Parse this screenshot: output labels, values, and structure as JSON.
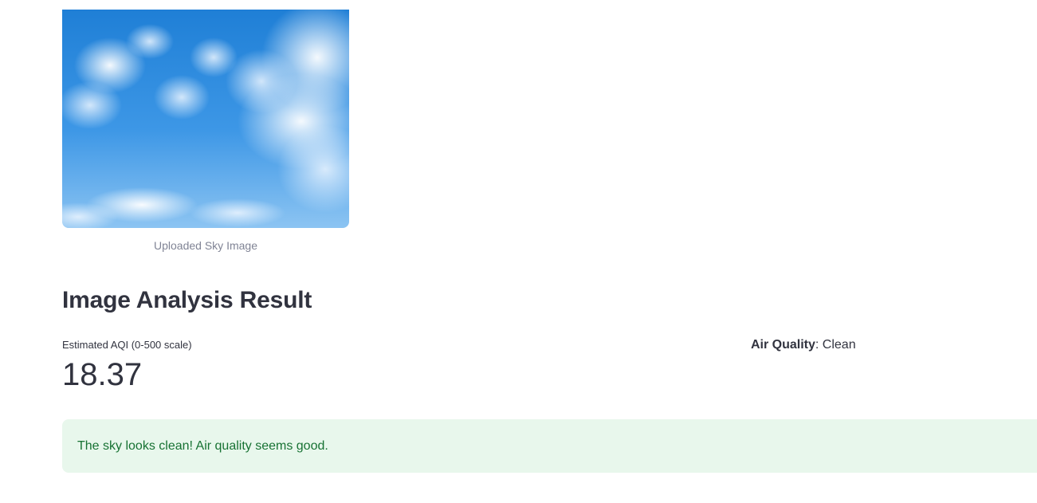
{
  "image": {
    "caption": "Uploaded Sky Image",
    "icon": "sky-photo"
  },
  "result": {
    "title": "Image Analysis Result"
  },
  "metric": {
    "label": "Estimated AQI (0-500 scale)",
    "value": "18.37"
  },
  "air_quality": {
    "label": "Air Quality",
    "separator": ": ",
    "value": "Clean"
  },
  "alert": {
    "message": "The sky looks clean! Air quality seems good.",
    "background": "#e8f7ec",
    "text_color": "#177233"
  }
}
